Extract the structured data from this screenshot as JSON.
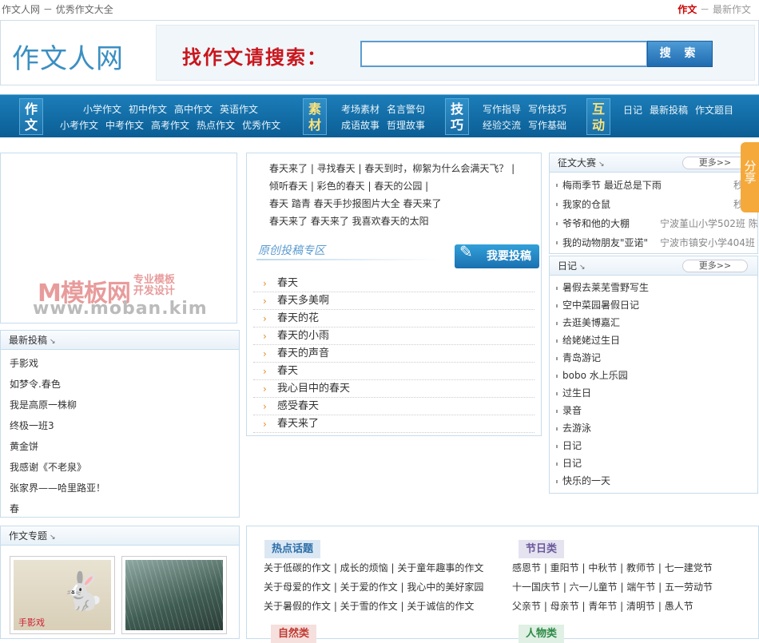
{
  "topbar": {
    "site_name": "作文人网",
    "separator": "－",
    "tagline": "优秀作文大全",
    "link_essay": "作文",
    "link_newest": "最新作文"
  },
  "header": {
    "logo": "作文人网",
    "search_label": "找作文请搜索：",
    "search_value": "",
    "search_button": "搜 索"
  },
  "nav": {
    "groups": [
      {
        "cat": "作文",
        "rows": [
          [
            "小学作文",
            "初中作文",
            "高中作文",
            "英语作文"
          ],
          [
            "小考作文",
            "中考作文",
            "高考作文",
            "热点作文",
            "优秀作文"
          ]
        ]
      },
      {
        "cat": "素材",
        "rows": [
          [
            "考场素材",
            "名言警句"
          ],
          [
            "成语故事",
            "哲理故事"
          ]
        ]
      },
      {
        "cat": "技巧",
        "rows": [
          [
            "写作指导",
            "写作技巧"
          ],
          [
            "经验交流",
            "写作基础"
          ]
        ]
      },
      {
        "cat": "互动",
        "rows": [
          [
            "日记",
            "最新投稿",
            "作文题目"
          ]
        ]
      }
    ]
  },
  "ad": {
    "wm_main": "M模板网",
    "wm_side1": "专业模板",
    "wm_side2": "开发设计",
    "wm_url": "www.moban.kim"
  },
  "latest": {
    "title": "最新投稿",
    "items": [
      "手影戏",
      "如梦令.春色",
      "我是高原一株柳",
      "终极一班3",
      "黄金饼",
      "我感谢《不老泉》",
      "张家界——哈里路亚！",
      "春"
    ]
  },
  "tags": {
    "lines": [
      "春天来了 | 寻找春天 | 春天到时，柳絮为什么会满天飞？ |",
      "倾听春天 | 彩色的春天 | 春天的公园 |",
      "春天 踏青  春天手抄报图片大全  春天来了",
      "春天来了  春天来了  我喜欢春天的太阳"
    ]
  },
  "contrib": {
    "title": "原创投稿专区",
    "button": "我要投稿",
    "items": [
      "春天",
      "春天多美啊",
      "春天的花",
      "春天的小雨",
      "春天的声音",
      "春天",
      "我心目中的春天",
      "感受春天",
      "春天来了"
    ]
  },
  "contest": {
    "title": "征文大赛",
    "more": "更多>>",
    "items": [
      {
        "title": "梅雨季节 最近总是下雨",
        "meta": "秒"
      },
      {
        "title": "我家的仓鼠",
        "meta": "秒"
      },
      {
        "title": "爷爷和他的大棚",
        "meta": "宁波堇山小学502班 陈"
      },
      {
        "title": "我的动物朋友\"亚诺\"",
        "meta": "宁波市镇安小学404班"
      }
    ]
  },
  "diary": {
    "title": "日记",
    "more": "更多>>",
    "items": [
      "暑假去莱芜雪野写生",
      "空中菜园暑假日记",
      "去逛美博嘉汇",
      "给姥姥过生日",
      "青岛游记",
      "bobo 水上乐园",
      "过生日",
      "录音",
      "去游泳",
      "日记",
      "日记",
      "快乐的一天"
    ]
  },
  "share": {
    "label": "分享"
  },
  "topics": {
    "title": "作文专题",
    "thumb1_title": "手影戏"
  },
  "hot": {
    "h1": "热点话题",
    "h2": "节日类",
    "h3": "自然类",
    "h4": "人物类",
    "l1": [
      "关于低碳的作文 | 成长的烦恼 | 关于童年趣事的作文",
      "关于母爱的作文 | 关于爱的作文 | 我心中的美好家园",
      "关于暑假的作文 | 关于雪的作文 | 关于诚信的作文"
    ],
    "l2": [
      "感恩节 | 重阳节 | 中秋节 | 教师节 | 七一建党节",
      "十一国庆节 | 六一儿童节 | 端午节 | 五一劳动节",
      "父亲节 | 母亲节 | 青年节 | 清明节 | 愚人节"
    ]
  }
}
